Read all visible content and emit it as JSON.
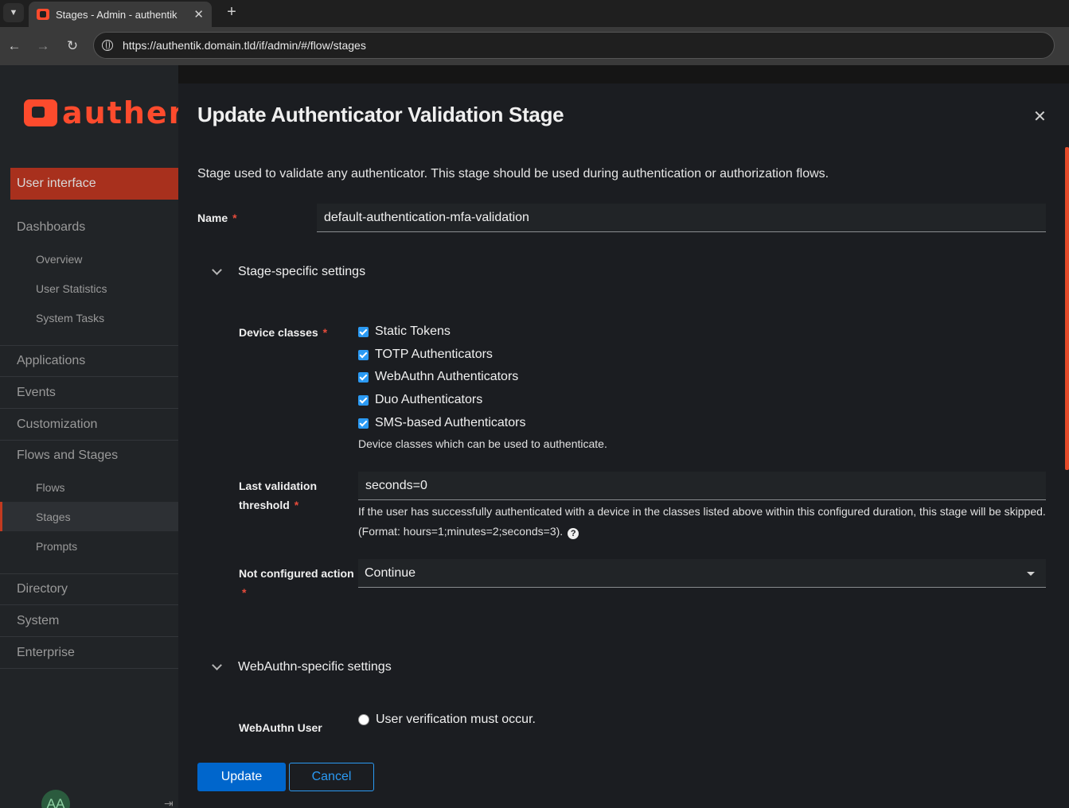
{
  "browser": {
    "tab_title": "Stages - Admin - authentik",
    "url": "https://authentik.domain.tld/if/admin/#/flow/stages"
  },
  "sidebar": {
    "logo_text": "authent",
    "user_interface": "User interface",
    "items": [
      {
        "label": "Dashboards"
      },
      {
        "label": "Overview"
      },
      {
        "label": "User Statistics"
      },
      {
        "label": "System Tasks"
      },
      {
        "label": "Applications"
      },
      {
        "label": "Events"
      },
      {
        "label": "Customization"
      },
      {
        "label": "Flows and Stages"
      },
      {
        "label": "Flows"
      },
      {
        "label": "Stages"
      },
      {
        "label": "Prompts"
      },
      {
        "label": "Directory"
      },
      {
        "label": "System"
      },
      {
        "label": "Enterprise"
      }
    ],
    "avatar_initials": "AA"
  },
  "modal": {
    "title": "Update Authenticator Validation Stage",
    "description": "Stage used to validate any authenticator. This stage should be used during authentication or authorization flows.",
    "name_label": "Name",
    "name_value": "default-authentication-mfa-validation",
    "stage_section": "Stage-specific settings",
    "device_classes_label": "Device classes",
    "device_classes": [
      {
        "label": "Static Tokens",
        "checked": true
      },
      {
        "label": "TOTP Authenticators",
        "checked": true
      },
      {
        "label": "WebAuthn Authenticators",
        "checked": true
      },
      {
        "label": "Duo Authenticators",
        "checked": true
      },
      {
        "label": "SMS-based Authenticators",
        "checked": true
      }
    ],
    "device_classes_help": "Device classes which can be used to authenticate.",
    "last_validation_label_1": "Last validation",
    "last_validation_label_2": "threshold",
    "last_validation_value": "seconds=0",
    "last_validation_help_1": "If the user has successfully authenticated with a device in the classes listed above within this configured duration, this stage will be skipped.",
    "last_validation_help_2": "(Format: hours=1;minutes=2;seconds=3).",
    "not_configured_label": "Not configured action",
    "not_configured_value": "Continue",
    "webauthn_section": "WebAuthn-specific settings",
    "webauthn_user_label": "WebAuthn User",
    "webauthn_option": "User verification must occur.",
    "update_label": "Update",
    "cancel_label": "Cancel"
  },
  "colors": {
    "brand": "#fd4b2d",
    "primary": "#0066cc",
    "checkbox": "#2b9af3"
  }
}
